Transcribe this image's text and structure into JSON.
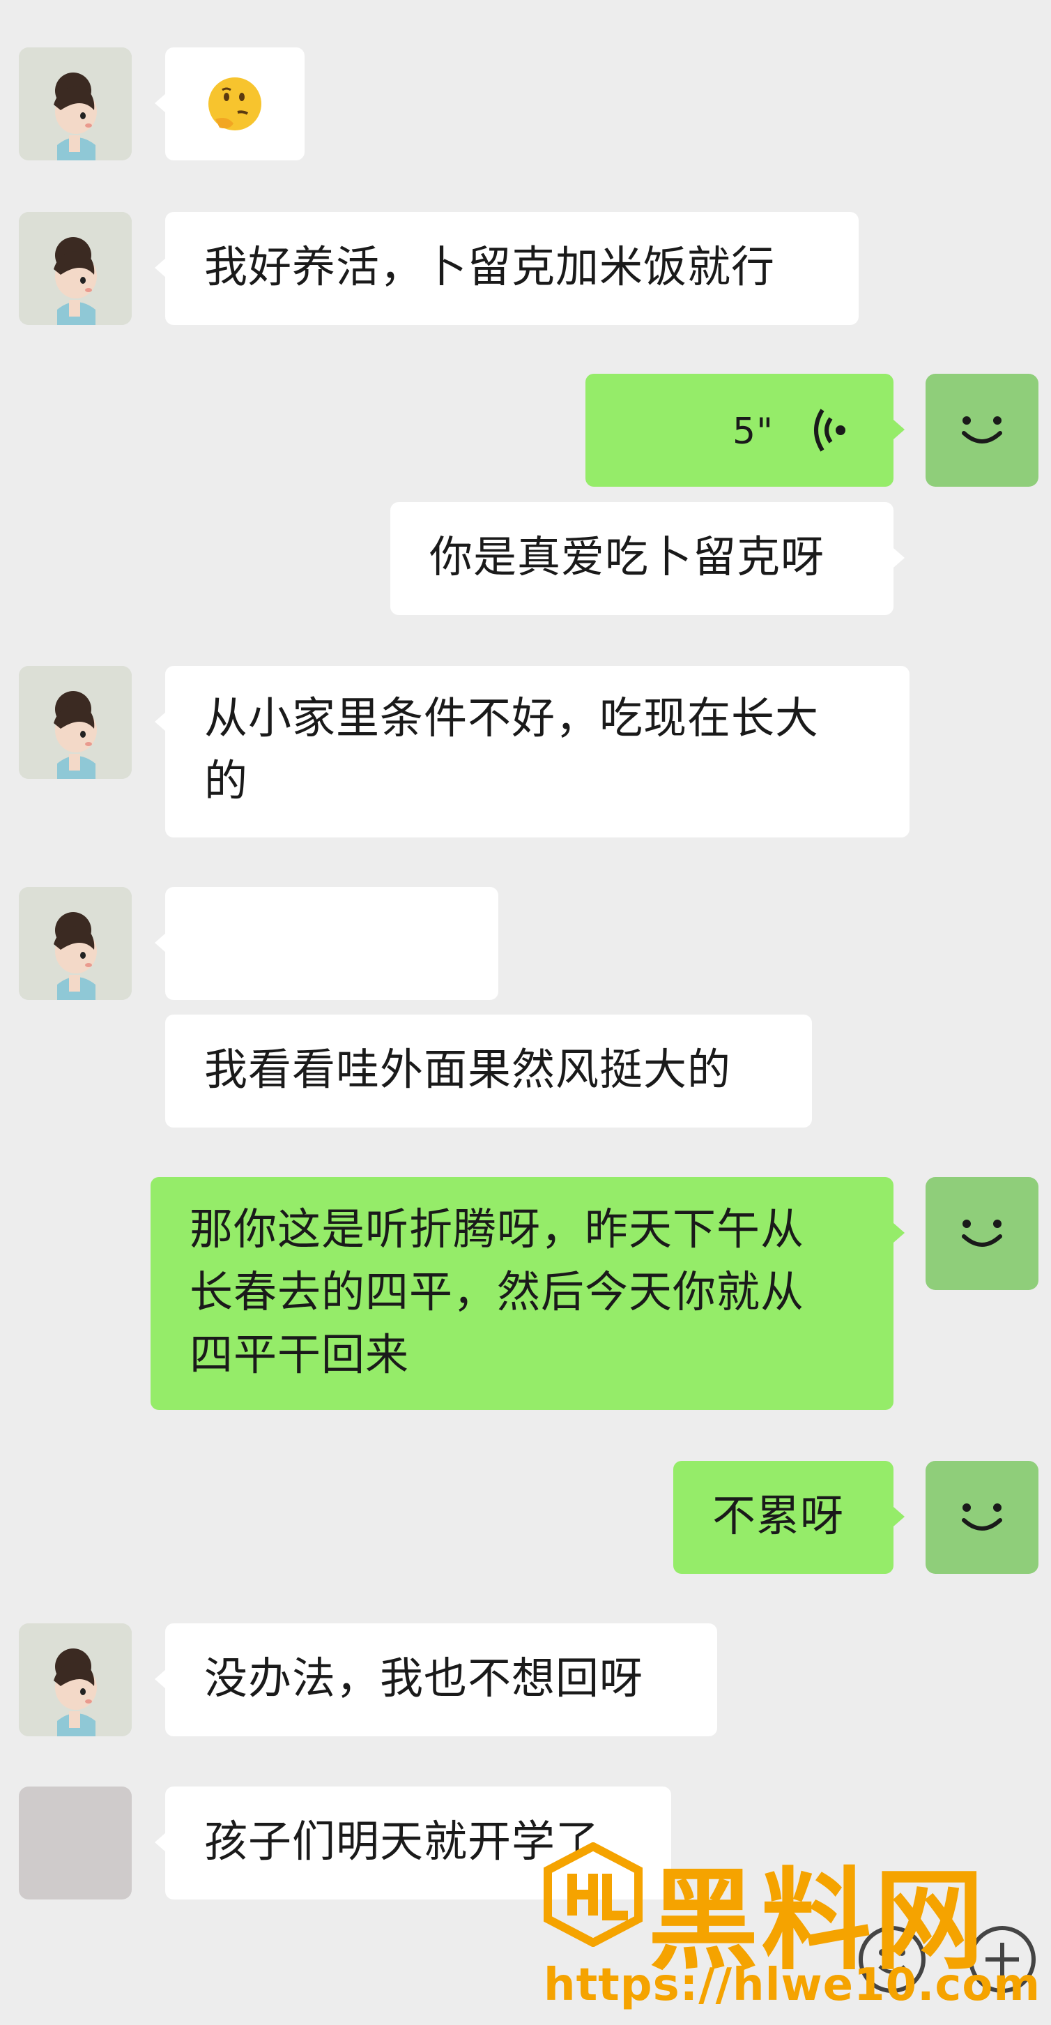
{
  "messages": [
    {
      "side": "left",
      "type": "emoji",
      "emoji": "🤔"
    },
    {
      "side": "left",
      "type": "text",
      "text": "我好养活，卜留克加米饭就行"
    },
    {
      "side": "right",
      "type": "voice",
      "duration": "5\""
    },
    {
      "side": "right",
      "type": "text",
      "text": "你是真爱吃卜留克呀"
    },
    {
      "side": "left",
      "type": "text",
      "text": "从小家里条件不好，吃现在长大\n的"
    },
    {
      "side": "left",
      "type": "blank",
      "text": ""
    },
    {
      "side": "left",
      "type": "text",
      "text": "我看看哇外面果然风挺大的"
    },
    {
      "side": "right",
      "type": "text",
      "text": "那你这是听折腾呀，昨天下午从\n长春去的四平，然后今天你就从\n四平干回来"
    },
    {
      "side": "right",
      "type": "text",
      "text": "不累呀"
    },
    {
      "side": "left",
      "type": "text",
      "text": "没办法，我也不想回呀"
    },
    {
      "side": "left",
      "type": "text",
      "text": "孩子们明天就开学了"
    }
  ],
  "watermark": {
    "brand": "黑料网",
    "url": "https://hlwe10.com"
  },
  "colors": {
    "background": "#ededed",
    "bubble_left": "#ffffff",
    "bubble_right": "#95ec69",
    "avatar_me": "#8fce7a",
    "watermark": "#f5a300"
  }
}
